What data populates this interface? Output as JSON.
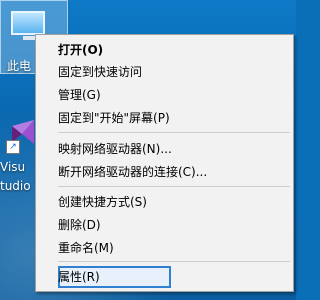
{
  "desktop": {
    "this_pc_label": "此电",
    "vs_label_line1": "Visu",
    "vs_label_line2": "tudio"
  },
  "context_menu": {
    "items": [
      {
        "label": "打开(O)",
        "bold": true
      },
      {
        "label": "固定到快速访问"
      },
      {
        "label": "管理(G)"
      },
      {
        "label": "固定到\"开始\"屏幕(P)"
      },
      {
        "label": "映射网络驱动器(N)..."
      },
      {
        "label": "断开网络驱动器的连接(C)..."
      },
      {
        "label": "创建快捷方式(S)"
      },
      {
        "label": "删除(D)"
      },
      {
        "label": "重命名(M)"
      },
      {
        "label": "属性(R)",
        "highlighted": true
      }
    ]
  },
  "colors": {
    "desktop_bg": "#0b6fb8",
    "menu_bg": "#f2f2f2",
    "highlight_border": "#2f80d0"
  },
  "icons": [
    "this-pc-icon",
    "visual-studio-icon",
    "shortcut-arrow-icon",
    "mouse-cursor-icon"
  ]
}
